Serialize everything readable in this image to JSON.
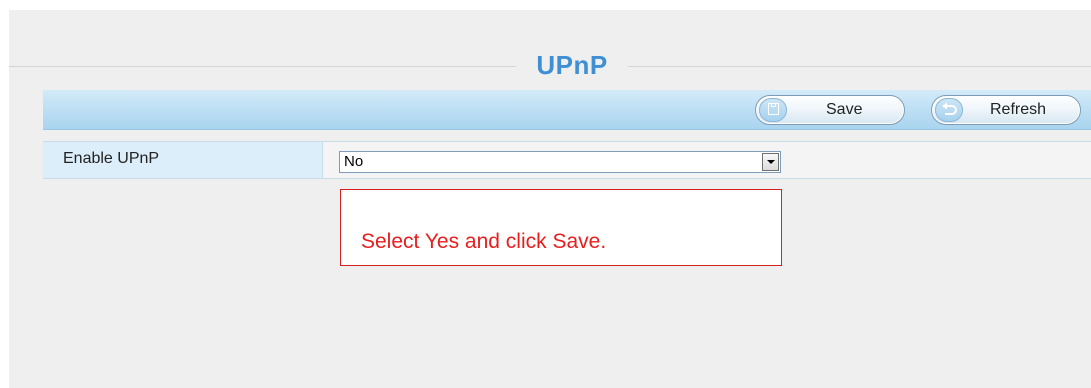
{
  "page": {
    "title": "UPnP"
  },
  "toolbar": {
    "save_label": "Save",
    "refresh_label": "Refresh",
    "save_icon": "floppy-disk-icon",
    "refresh_icon": "refresh-arrow-icon"
  },
  "form": {
    "enable_upnp": {
      "label": "Enable UPnP",
      "selected_value": "No"
    }
  },
  "annotation": {
    "text": "Select Yes and click Save."
  },
  "colors": {
    "title": "#3f8fd5",
    "toolbar": "#bfe0f4",
    "label_cell": "#dceefa",
    "annotation": "#e81e1e"
  }
}
